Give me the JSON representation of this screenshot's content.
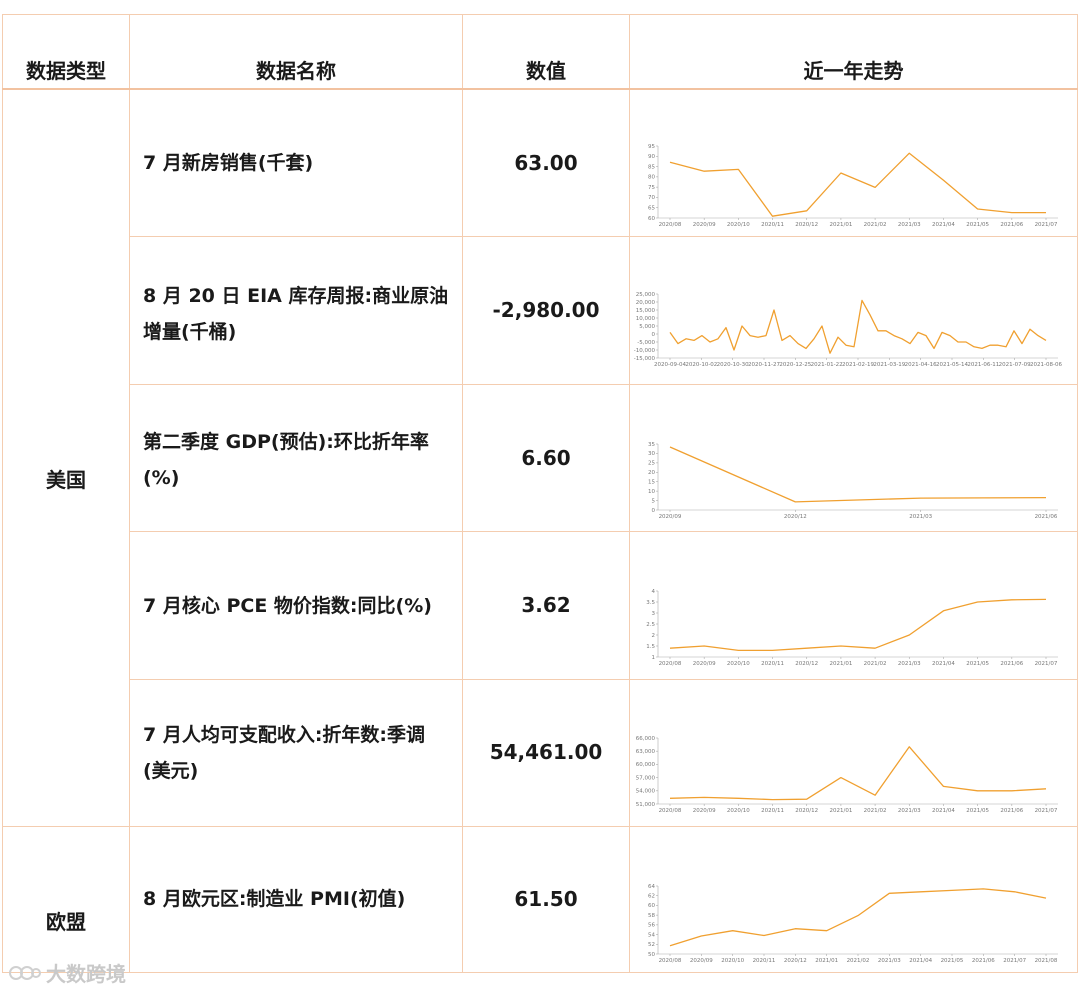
{
  "header": {
    "col_type": "数据类型",
    "col_name": "数据名称",
    "col_value": "数值",
    "col_trend": "近一年走势"
  },
  "groups": [
    {
      "name": "美国"
    },
    {
      "name": "欧盟"
    }
  ],
  "rows": [
    {
      "name_l1": "7 月新房销售(千套)",
      "name_l2": "",
      "value": "63.00"
    },
    {
      "name_l1": "8 月 20 日 EIA 库存周报:商业原油",
      "name_l2": "增量(千桶)",
      "value": "-2,980.00"
    },
    {
      "name_l1": "第二季度 GDP(预估):环比折年率",
      "name_l2": "(%)",
      "value": "6.60"
    },
    {
      "name_l1": "7 月核心 PCE 物价指数:同比(%)",
      "name_l2": "",
      "value": "3.62"
    },
    {
      "name_l1": "7 月人均可支配收入:折年数:季调",
      "name_l2": "(美元)",
      "value": "54,461.00"
    },
    {
      "name_l1": "8 月欧元区:制造业 PMI(初值)",
      "name_l2": "",
      "value": "61.50"
    }
  ],
  "chart_data": [
    {
      "type": "line",
      "color": "#f0a030",
      "x": [
        "2020/08",
        "2020/09",
        "2020/10",
        "2020/11",
        "2020/12",
        "2021/01",
        "2021/02",
        "2021/03",
        "2021/04",
        "2021/05",
        "2021/06",
        "2021/07"
      ],
      "values": [
        91,
        86,
        87,
        61,
        64,
        85,
        77,
        96,
        81,
        65,
        63,
        63
      ],
      "ylim": [
        60,
        100
      ],
      "yticks": [
        "60",
        "65",
        "70",
        "75",
        "80",
        "85",
        "90",
        "95"
      ]
    },
    {
      "type": "line",
      "color": "#f0a030",
      "x": [
        "2020-09-04",
        "2020-10-02",
        "2020-10-30",
        "2020-11-27",
        "2020-12-25",
        "2021-01-22",
        "2021-02-19",
        "2021-03-19",
        "2021-04-16",
        "2021-05-14",
        "2021-06-11",
        "2021-07-09",
        "2021-08-06"
      ],
      "values": [
        1000,
        -6000,
        -3000,
        -4000,
        -1000,
        -5000,
        -3000,
        4000,
        -10000,
        5000,
        -1000,
        -2000,
        -1000,
        15000,
        -4000,
        -1000,
        -6000,
        -9000,
        -3000,
        5000,
        -12000,
        -2000,
        -7000,
        -8000,
        21000,
        12000,
        2000,
        2000,
        -1000,
        -3000,
        -6000,
        1000,
        -1000,
        -9000,
        1000,
        -1000,
        -5000,
        -5000,
        -8000,
        -9000,
        -7000,
        -7000,
        -8000,
        2000,
        -6000,
        3000,
        -1000,
        -4000
      ],
      "ylim": [
        -15000,
        25000
      ],
      "yticks": [
        "-15,000",
        "-10,000",
        "-5,000",
        "0",
        "5,000",
        "10,000",
        "15,000",
        "20,000",
        "25,000"
      ]
    },
    {
      "type": "line",
      "color": "#f0a030",
      "x": [
        "2020/09",
        "2020/12",
        "2021/03",
        "2021/06"
      ],
      "values": [
        33.4,
        4.3,
        6.3,
        6.6
      ],
      "ylim": [
        0,
        35
      ],
      "yticks": [
        "0",
        "5",
        "10",
        "15",
        "20",
        "25",
        "30",
        "35"
      ]
    },
    {
      "type": "line",
      "color": "#f0a030",
      "x": [
        "2020/08",
        "2020/09",
        "2020/10",
        "2020/11",
        "2020/12",
        "2021/01",
        "2021/02",
        "2021/03",
        "2021/04",
        "2021/05",
        "2021/06",
        "2021/07"
      ],
      "values": [
        1.4,
        1.5,
        1.3,
        1.3,
        1.4,
        1.5,
        1.4,
        2.0,
        3.1,
        3.5,
        3.6,
        3.62
      ],
      "ylim": [
        1,
        4
      ],
      "yticks": [
        "1",
        "1.5",
        "2",
        "2.5",
        "3",
        "3.5",
        "4"
      ]
    },
    {
      "type": "line",
      "color": "#f0a030",
      "x": [
        "2020/08",
        "2020/09",
        "2020/10",
        "2020/11",
        "2020/12",
        "2021/01",
        "2021/02",
        "2021/03",
        "2021/04",
        "2021/05",
        "2021/06",
        "2021/07"
      ],
      "values": [
        52300,
        52500,
        52300,
        52000,
        52100,
        57000,
        53000,
        64000,
        55000,
        54000,
        54000,
        54461
      ],
      "ylim": [
        51000,
        66000
      ],
      "yticks": [
        "51,000",
        "54,000",
        "57,000",
        "60,000",
        "63,000",
        "66,000"
      ]
    },
    {
      "type": "line",
      "color": "#f0a030",
      "x": [
        "2020/08",
        "2020/09",
        "2020/10",
        "2020/11",
        "2020/12",
        "2021/01",
        "2021/02",
        "2021/03",
        "2021/04",
        "2021/05",
        "2021/06",
        "2021/07",
        "2021/08"
      ],
      "values": [
        51.7,
        53.7,
        54.8,
        53.8,
        55.2,
        54.8,
        57.9,
        62.5,
        62.8,
        63.1,
        63.4,
        62.8,
        61.5
      ],
      "ylim": [
        50,
        64
      ],
      "yticks": [
        "50",
        "52",
        "54",
        "56",
        "58",
        "60",
        "62",
        "64"
      ]
    }
  ],
  "watermark": {
    "text": "大数跨境"
  }
}
